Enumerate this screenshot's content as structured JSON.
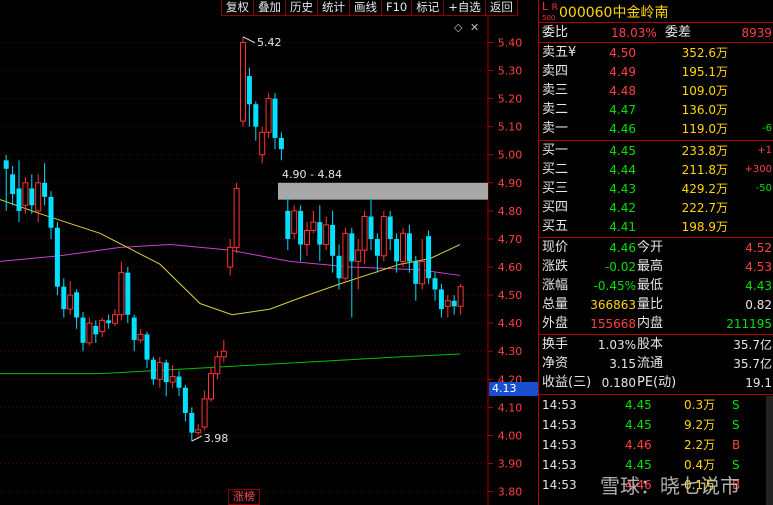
{
  "toolbar": [
    "复权",
    "叠加",
    "历史",
    "统计",
    "画线",
    "F10",
    "标记",
    "+自选",
    "返回"
  ],
  "chart_data": {
    "type": "candlestick",
    "ylim": [
      3.77,
      5.48
    ],
    "yticks": [
      "5.40",
      "5.30",
      "5.20",
      "5.10",
      "5.00",
      "4.90",
      "4.80",
      "4.70",
      "4.60",
      "4.50",
      "4.40",
      "4.30",
      "4.20",
      "4.10",
      "4.00",
      "3.90",
      "3.80"
    ],
    "candles": [
      [
        4.98,
        4.95,
        5.0,
        4.8
      ],
      [
        4.93,
        4.86,
        4.96,
        4.82
      ],
      [
        4.88,
        4.8,
        4.98,
        4.76
      ],
      [
        4.82,
        4.9,
        4.92,
        4.79
      ],
      [
        4.88,
        4.82,
        4.93,
        4.79
      ],
      [
        4.8,
        4.9,
        4.93,
        4.76
      ],
      [
        4.9,
        4.85,
        4.97,
        4.82
      ],
      [
        4.85,
        4.74,
        4.87,
        4.7
      ],
      [
        4.74,
        4.53,
        4.76,
        4.5
      ],
      [
        4.53,
        4.45,
        4.56,
        4.42
      ],
      [
        4.45,
        4.5,
        4.55,
        4.43
      ],
      [
        4.51,
        4.42,
        4.52,
        4.38
      ],
      [
        4.42,
        4.33,
        4.44,
        4.3
      ],
      [
        4.33,
        4.4,
        4.42,
        4.32
      ],
      [
        4.39,
        4.36,
        4.41,
        4.33
      ],
      [
        4.37,
        4.41,
        4.42,
        4.35
      ],
      [
        4.41,
        4.4,
        4.43,
        4.38
      ],
      [
        4.4,
        4.43,
        4.45,
        4.39
      ],
      [
        4.43,
        4.58,
        4.62,
        4.41
      ],
      [
        4.58,
        4.43,
        4.6,
        4.4
      ],
      [
        4.42,
        4.34,
        4.43,
        4.3
      ],
      [
        4.34,
        4.36,
        4.38,
        4.33
      ],
      [
        4.36,
        4.27,
        4.37,
        4.24
      ],
      [
        4.27,
        4.2,
        4.28,
        4.18
      ],
      [
        4.2,
        4.26,
        4.28,
        4.17
      ],
      [
        4.26,
        4.19,
        4.27,
        4.14
      ],
      [
        4.19,
        4.21,
        4.25,
        4.17
      ],
      [
        4.21,
        4.17,
        4.23,
        4.14
      ],
      [
        4.17,
        4.08,
        4.18,
        4.05
      ],
      [
        4.08,
        4.01,
        4.1,
        3.98
      ],
      [
        4.01,
        4.02,
        4.04,
        4.0
      ],
      [
        4.03,
        4.13,
        4.16,
        4.02
      ],
      [
        4.13,
        4.22,
        4.24,
        4.12
      ],
      [
        4.22,
        4.28,
        4.3,
        4.2
      ],
      [
        4.28,
        4.3,
        4.34,
        4.26
      ],
      [
        4.6,
        4.67,
        4.7,
        4.57
      ],
      [
        4.67,
        4.88,
        4.9,
        4.65
      ],
      [
        5.12,
        5.4,
        5.42,
        5.1
      ],
      [
        5.28,
        5.18,
        5.31,
        5.1
      ],
      [
        5.18,
        5.1,
        5.19,
        5.05
      ],
      [
        5.0,
        5.08,
        5.1,
        4.97
      ],
      [
        5.08,
        5.2,
        5.22,
        5.06
      ],
      [
        5.2,
        5.06,
        5.22,
        5.02
      ],
      [
        5.06,
        5.02,
        5.08,
        4.98
      ],
      [
        4.8,
        4.7,
        4.85,
        4.66
      ],
      [
        4.72,
        4.8,
        4.82,
        4.7
      ],
      [
        4.8,
        4.68,
        4.82,
        4.62
      ],
      [
        4.68,
        4.73,
        4.76,
        4.64
      ],
      [
        4.73,
        4.76,
        4.8,
        4.72
      ],
      [
        4.76,
        4.68,
        4.82,
        4.62
      ],
      [
        4.68,
        4.75,
        4.78,
        4.66
      ],
      [
        4.75,
        4.64,
        4.8,
        4.58
      ],
      [
        4.64,
        4.56,
        4.68,
        4.52
      ],
      [
        4.56,
        4.72,
        4.74,
        4.55
      ],
      [
        4.72,
        4.62,
        4.74,
        4.42
      ],
      [
        4.62,
        4.66,
        4.7,
        4.52
      ],
      [
        4.66,
        4.78,
        4.8,
        4.61
      ],
      [
        4.78,
        4.7,
        4.85,
        4.66
      ],
      [
        4.7,
        4.64,
        4.72,
        4.58
      ],
      [
        4.64,
        4.78,
        4.8,
        4.62
      ],
      [
        4.78,
        4.7,
        4.8,
        4.66
      ],
      [
        4.7,
        4.62,
        4.72,
        4.58
      ],
      [
        4.62,
        4.72,
        4.74,
        4.6
      ],
      [
        4.72,
        4.62,
        4.75,
        4.58
      ],
      [
        4.62,
        4.54,
        4.64,
        4.48
      ],
      [
        4.54,
        4.62,
        4.7,
        4.52
      ],
      [
        4.71,
        4.56,
        4.73,
        4.54
      ],
      [
        4.56,
        4.52,
        4.58,
        4.48
      ],
      [
        4.52,
        4.45,
        4.54,
        4.42
      ],
      [
        4.46,
        4.48,
        4.5,
        4.42
      ],
      [
        4.48,
        4.46,
        4.5,
        4.43
      ],
      [
        4.46,
        4.53,
        4.54,
        4.43
      ]
    ],
    "ma_yellow": [
      [
        0,
        4.84
      ],
      [
        40,
        4.79
      ],
      [
        100,
        4.72
      ],
      [
        160,
        4.61
      ],
      [
        200,
        4.47
      ],
      [
        232,
        4.43
      ],
      [
        270,
        4.45
      ],
      [
        300,
        4.49
      ],
      [
        340,
        4.54
      ],
      [
        400,
        4.61
      ],
      [
        430,
        4.63
      ],
      [
        460,
        4.68
      ]
    ],
    "ma_purple": [
      [
        0,
        4.62
      ],
      [
        60,
        4.64
      ],
      [
        120,
        4.67
      ],
      [
        170,
        4.68
      ],
      [
        230,
        4.66
      ],
      [
        290,
        4.62
      ],
      [
        350,
        4.6
      ],
      [
        420,
        4.59
      ],
      [
        460,
        4.57
      ]
    ],
    "ma_green": [
      [
        0,
        4.22
      ],
      [
        100,
        4.22
      ],
      [
        200,
        4.24
      ],
      [
        300,
        4.26
      ],
      [
        400,
        4.28
      ],
      [
        460,
        4.29
      ]
    ],
    "box": {
      "low": 4.84,
      "high": 4.9,
      "label": "4.90 - 4.84"
    },
    "high_label": "5.42",
    "low_label": "3.98"
  },
  "current_price_tag": "4.13",
  "zhangbang": "涨榜",
  "stock": {
    "lr_top": "L",
    "lr_r": "R",
    "lr_num": "500",
    "code": "000060",
    "name": "中金岭南"
  },
  "weibi": {
    "label1": "委比",
    "val1": "18.03%",
    "label2": "委差",
    "val2": "8939"
  },
  "asks": [
    {
      "label": "卖五¥",
      "price": "4.50",
      "vol": "352.6万",
      "chg": ""
    },
    {
      "label": "卖四",
      "price": "4.49",
      "vol": "195.1万",
      "chg": ""
    },
    {
      "label": "卖三",
      "price": "4.48",
      "vol": "109.0万",
      "chg": ""
    },
    {
      "label": "卖二",
      "price": "4.47",
      "vol": "136.0万",
      "chg": ""
    },
    {
      "label": "卖一",
      "price": "4.46",
      "vol": "119.0万",
      "chg": "-6"
    }
  ],
  "bids": [
    {
      "label": "买一",
      "price": "4.45",
      "vol": "233.8万",
      "chg": "+1"
    },
    {
      "label": "买二",
      "price": "4.44",
      "vol": "211.8万",
      "chg": "+300"
    },
    {
      "label": "买三",
      "price": "4.43",
      "vol": "429.2万",
      "chg": "-50"
    },
    {
      "label": "买四",
      "price": "4.42",
      "vol": "222.7万",
      "chg": ""
    },
    {
      "label": "买五",
      "price": "4.41",
      "vol": "198.9万",
      "chg": ""
    }
  ],
  "quote": [
    {
      "l1": "现价",
      "v1": "4.46",
      "l2": "今开",
      "v2": "4.52"
    },
    {
      "l1": "涨跌",
      "v1": "-0.02",
      "l2": "最高",
      "v2": "4.53"
    },
    {
      "l1": "涨幅",
      "v1": "-0.45%",
      "l2": "最低",
      "v2": "4.43"
    },
    {
      "l1": "总量",
      "v1": "366863",
      "l2": "量比",
      "v2": "0.82"
    },
    {
      "l1": "外盘",
      "v1": "155668",
      "l2": "内盘",
      "v2": "211195"
    }
  ],
  "fundamentals": [
    {
      "l1": "换手",
      "v1": "1.03%",
      "l2": "股本",
      "v2": "35.7亿"
    },
    {
      "l1": "净资",
      "v1": "3.15",
      "l2": "流通",
      "v2": "35.7亿"
    },
    {
      "l1": "收益(三)",
      "v1": "0.180",
      "l2": "PE(动)",
      "v2": "19.1"
    }
  ],
  "ticks": [
    {
      "time": "14:53",
      "price": "4.45",
      "vol": "0.3万",
      "flag": "S"
    },
    {
      "time": "14:53",
      "price": "4.45",
      "vol": "9.2万",
      "flag": "S"
    },
    {
      "time": "14:53",
      "price": "4.46",
      "vol": "2.2万",
      "flag": "B"
    },
    {
      "time": "14:53",
      "price": "4.45",
      "vol": "0.4万",
      "flag": "S"
    },
    {
      "time": "14:53",
      "price": "4.46",
      "vol": "0.1万",
      "flag": "B"
    }
  ],
  "watermark": "雪球：晓七说市",
  "colors": {
    "up": "#ff3333",
    "down": "#00e0ff",
    "grid": "#b00000"
  }
}
